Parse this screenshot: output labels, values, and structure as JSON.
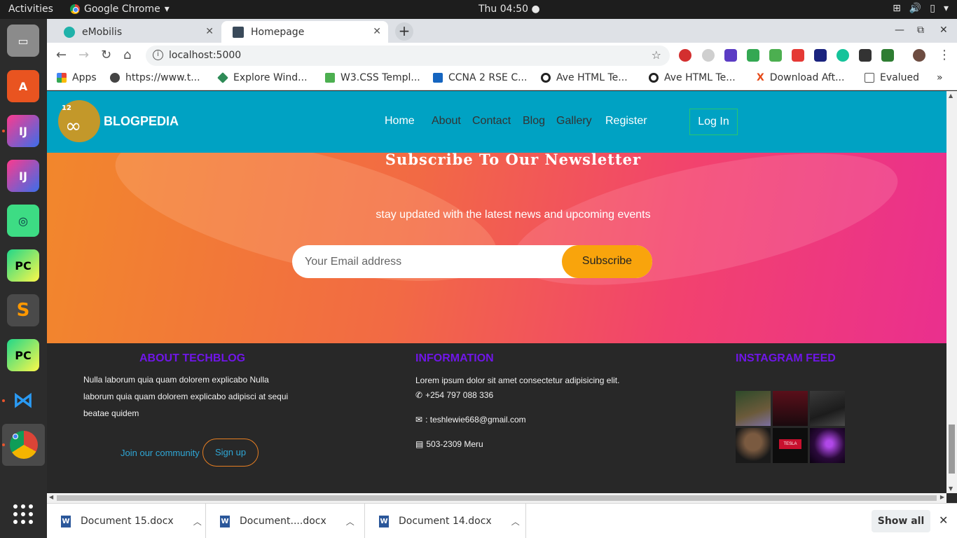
{
  "system": {
    "activities": "Activities",
    "app_name": "Google Chrome",
    "clock": "Thu 04:50"
  },
  "browser": {
    "tabs": [
      {
        "title": "eMobilis"
      },
      {
        "title": "Homepage"
      }
    ],
    "url": "localhost:5000",
    "bookmarks": [
      {
        "label": "Apps"
      },
      {
        "label": "https://www.t..."
      },
      {
        "label": "Explore Wind..."
      },
      {
        "label": "W3.CSS Templ..."
      },
      {
        "label": "CCNA 2 RSE C..."
      },
      {
        "label": "Ave HTML Te..."
      },
      {
        "label": "Ave HTML Te..."
      },
      {
        "label": "Download Aft..."
      },
      {
        "label": "Evalued"
      }
    ],
    "bookmarks_overflow": "»"
  },
  "site": {
    "logo_number": "12",
    "brand": "BLOGPEDIA",
    "nav": [
      "Home",
      "About",
      "Contact",
      "Blog",
      "Gallery",
      "Register"
    ],
    "login": "Log In",
    "newsletter": {
      "title": "Subscribe To Our Newsletter",
      "subtitle": "stay updated with the latest news and upcoming events",
      "placeholder": "Your Email address",
      "button": "Subscribe"
    },
    "footer": {
      "about_heading": "ABOUT TECHBLOG",
      "about_text": "Nulla laborum quia quam dolorem explicabo Nulla laborum quia quam dolorem explicabo adipisci at sequi beatae quidem",
      "join_text": "Join our community",
      "signup": "Sign up",
      "info_heading": "INFORMATION",
      "info_text": "Lorem ipsum dolor sit amet consectetur adipisicing elit.",
      "phone": "+254 797 088 336",
      "email": ": teshlewie668@gmail.com",
      "address": "503-2309 Meru",
      "instagram_heading": "INSTAGRAM FEED",
      "instagram_tile_text": "TESLA"
    }
  },
  "downloads": {
    "items": [
      {
        "name": "Document 15.docx"
      },
      {
        "name": "Document....docx"
      },
      {
        "name": "Document 14.docx"
      }
    ],
    "show_all": "Show all"
  },
  "colors": {
    "nav_bg": "#00a2c3",
    "accent_orange": "#f9a40c",
    "footer_heading": "#7016e8",
    "footer_bg": "#282828"
  }
}
